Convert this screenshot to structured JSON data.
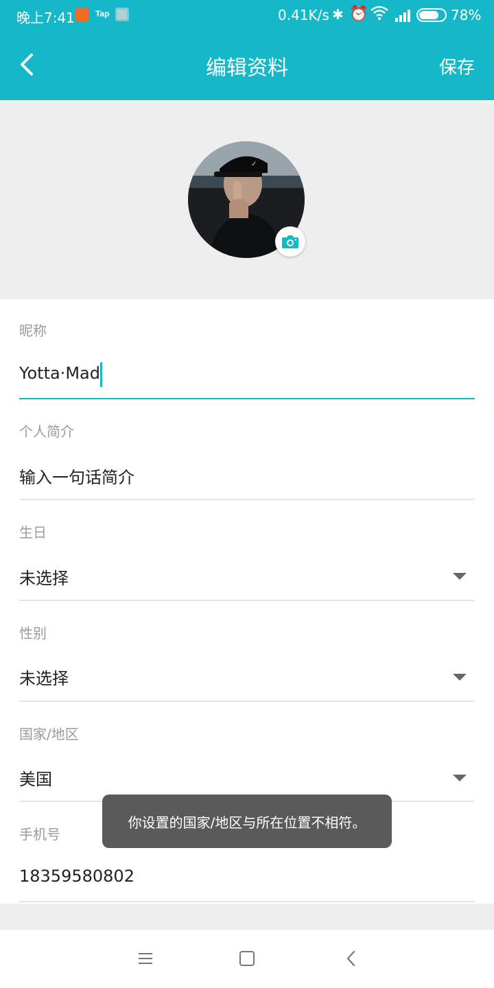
{
  "status_bar": {
    "time": "晚上7:41",
    "app_badge_tap": "Tap",
    "net_speed": "0.41K/s",
    "battery_level": 0.78,
    "battery_percent": "78%"
  },
  "app_bar": {
    "title": "编辑资料",
    "save_label": "保存"
  },
  "fields": {
    "nickname": {
      "label": "昵称",
      "value": "Yotta·Mad"
    },
    "bio": {
      "label": "个人简介",
      "placeholder": "输入一句话简介"
    },
    "birthday": {
      "label": "生日",
      "value": "未选择"
    },
    "gender": {
      "label": "性别",
      "value": "未选择"
    },
    "region": {
      "label": "国家/地区",
      "value": "美国"
    },
    "phone": {
      "label": "手机号",
      "value": "18359580802"
    }
  },
  "toast": "你设置的国家/地区与所在位置不相符。",
  "colors": {
    "accent": "#14b8c8",
    "background": "#eeeeee",
    "toast_bg": "#5a5a5a"
  }
}
